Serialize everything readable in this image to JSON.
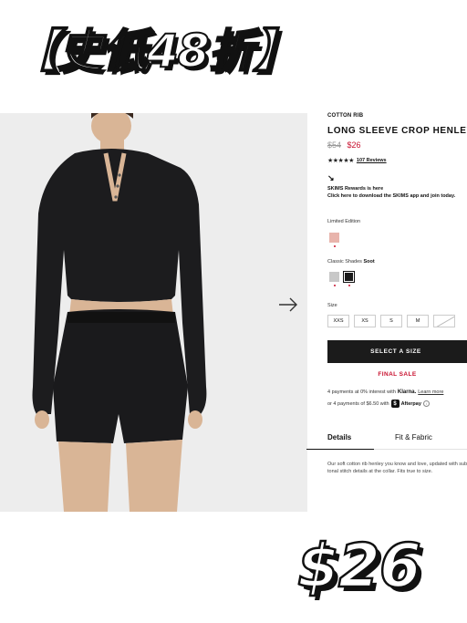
{
  "promo": {
    "headline": "【史低48折】"
  },
  "product": {
    "collection": "COTTON RIB",
    "title": "LONG SLEEVE CROP HENLEY",
    "original_price": "$54",
    "sale_price": "$26",
    "rating_stars": "★★★★★",
    "reviews_label": "107 Reviews"
  },
  "rewards": {
    "icon": "↘",
    "title": "SKIMS Rewards is here",
    "link": "Click here to download the SKIMS app and join today."
  },
  "colors": {
    "limited_label": "Limited Edition",
    "classic_label": "Classic Shades",
    "selected_shade": "Soot",
    "swatches": {
      "limited": "#e8b4ac",
      "grey": "#c8c8c8",
      "soot": "#1a1a1a"
    }
  },
  "size": {
    "label": "Size",
    "options": [
      "XXS",
      "XS",
      "S",
      "M"
    ]
  },
  "cta": {
    "select_size": "SELECT A SIZE",
    "final_sale": "FINAL SALE"
  },
  "payments": {
    "klarna_prefix": "4 payments at 0% interest with",
    "klarna_brand": "Klarna.",
    "learn_more": "Learn more",
    "afterpay_prefix": "or 4 payments of $6.50 with",
    "afterpay_brand": "Afterpay"
  },
  "tabs": {
    "details": "Details",
    "fit": "Fit & Fabric"
  },
  "description": "Our soft cotton rib henley you know and love, updated with subtle tonal stitch details at the collar. Fits true to size.",
  "overlay_price": "$26"
}
